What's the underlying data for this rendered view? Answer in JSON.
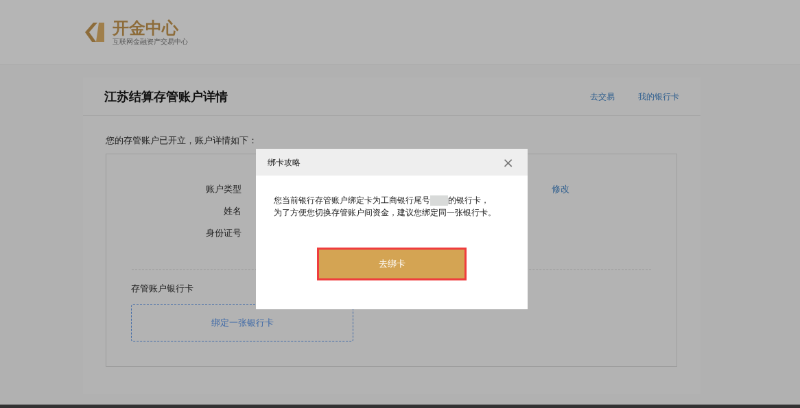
{
  "logo": {
    "name": "开金中心",
    "tagline": "互联网金融资产交易中心"
  },
  "panel": {
    "title": "江苏结算存管账户详情",
    "links": [
      "去交易",
      "我的银行卡"
    ]
  },
  "intro": "您的存管账户已开立，账户详情如下：",
  "fields": [
    {
      "label": "账户类型",
      "action": "修改"
    },
    {
      "label": "姓名"
    },
    {
      "label": "身份证号"
    }
  ],
  "bank_card": {
    "label": "存管账户银行卡",
    "add": "绑定一张银行卡"
  },
  "dialog": {
    "title": "绑卡攻略",
    "close": "×",
    "message_before": "您当前银行存管账户绑定卡为工商银行尾号",
    "message_after": "的银行卡，",
    "message_line2": "为了方便您切换存管账户间资金，建议您绑定同一张银行卡。",
    "button": "去绑卡"
  }
}
